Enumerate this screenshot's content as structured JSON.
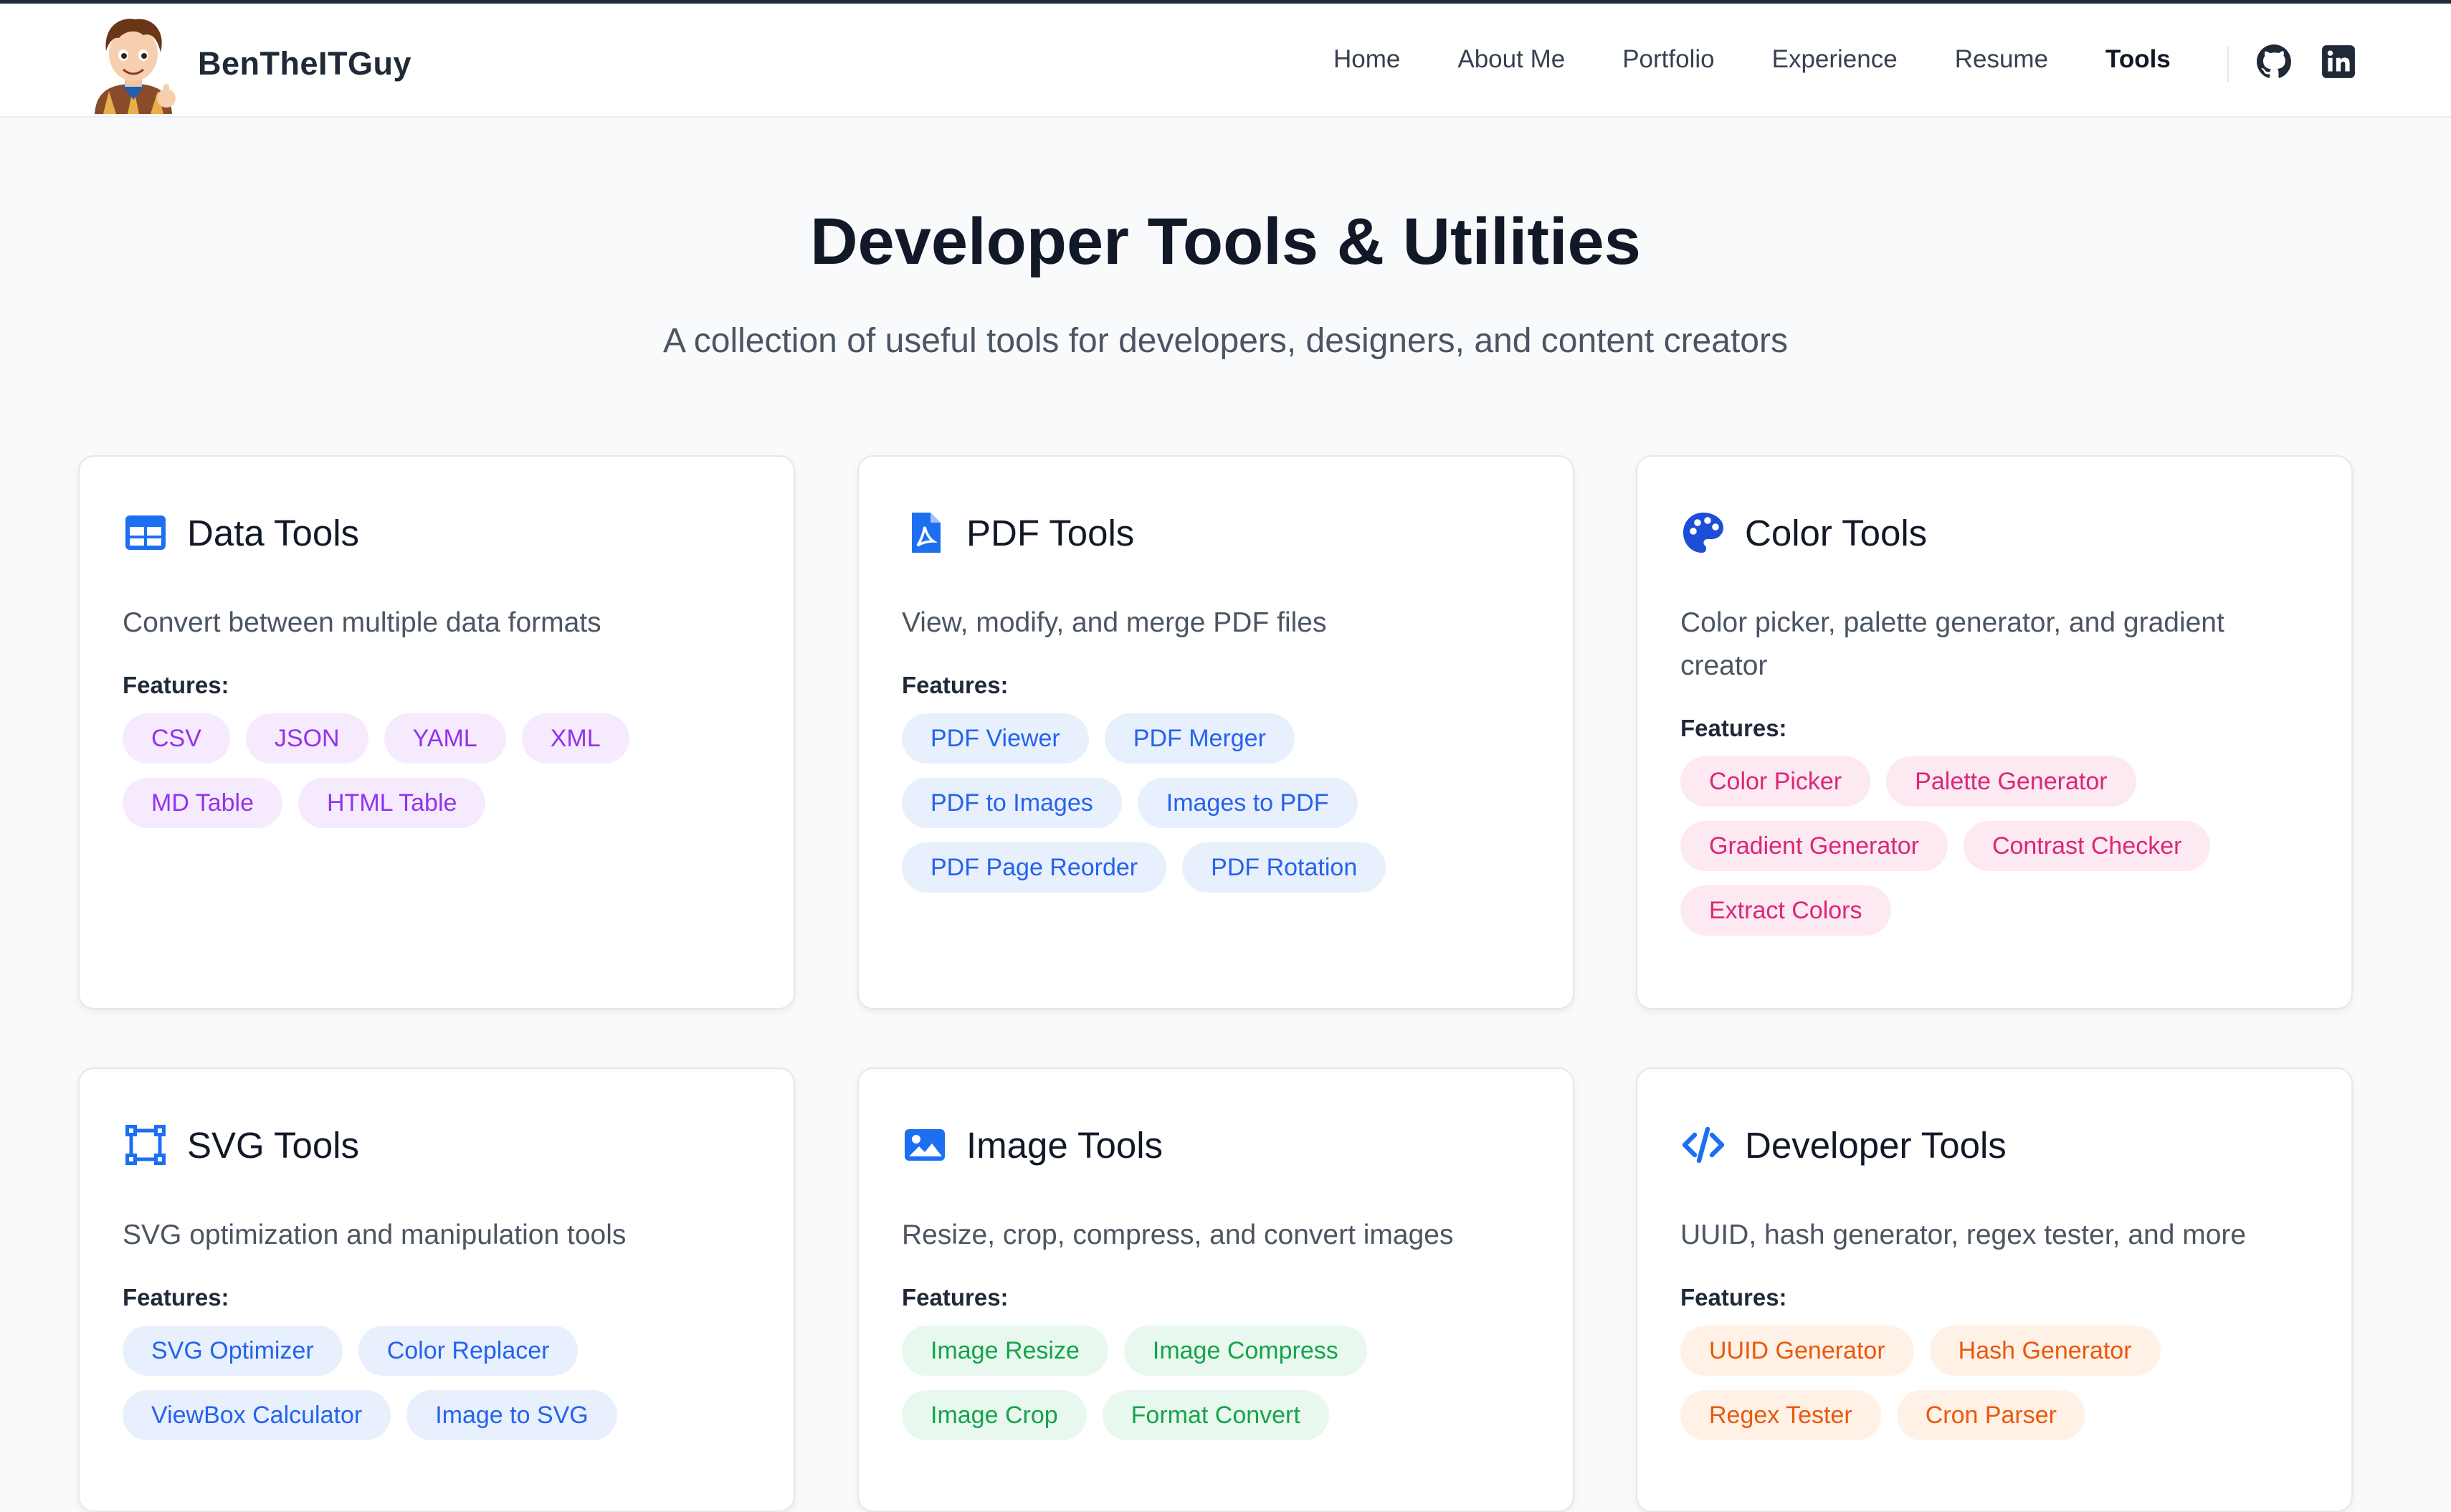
{
  "brand": {
    "name": "BenTheITGuy"
  },
  "nav": {
    "items": [
      {
        "label": "Home",
        "active": false
      },
      {
        "label": "About Me",
        "active": false
      },
      {
        "label": "Portfolio",
        "active": false
      },
      {
        "label": "Experience",
        "active": false
      },
      {
        "label": "Resume",
        "active": false
      },
      {
        "label": "Tools",
        "active": true
      }
    ],
    "social": [
      "github-icon",
      "linkedin-icon"
    ]
  },
  "hero": {
    "title": "Developer Tools & Utilities",
    "subtitle": "A collection of useful tools for developers, designers, and content creators"
  },
  "features_label": "Features:",
  "colors": {
    "purple_text": "#9333ea",
    "purple_bg": "#f5eafe",
    "blue_text": "#2563eb",
    "blue_bg": "#e8f0fe",
    "pink_text": "#db2777",
    "pink_bg": "#fde9f2",
    "green_text": "#16a34a",
    "green_bg": "#e8f8ee",
    "orange_text": "#ea580c",
    "orange_bg": "#fff1e6",
    "icon_blue": "#1d6ff2"
  },
  "cards": [
    {
      "title": "Data Tools",
      "icon": "table-icon",
      "description": "Convert between multiple data formats",
      "features": [
        "CSV",
        "JSON",
        "YAML",
        "XML",
        "MD Table",
        "HTML Table"
      ]
    },
    {
      "title": "PDF Tools",
      "icon": "pdf-file-icon",
      "description": "View, modify, and merge PDF files",
      "features": [
        "PDF Viewer",
        "PDF Merger",
        "PDF to Images",
        "Images to PDF",
        "PDF Page Reorder",
        "PDF Rotation"
      ]
    },
    {
      "title": "Color Tools",
      "icon": "palette-icon",
      "description": "Color picker, palette generator, and gradient creator",
      "features": [
        "Color Picker",
        "Palette Generator",
        "Gradient Generator",
        "Contrast Checker",
        "Extract Colors"
      ]
    },
    {
      "title": "SVG Tools",
      "icon": "vector-square-icon",
      "description": "SVG optimization and manipulation tools",
      "features": [
        "SVG Optimizer",
        "Color Replacer",
        "ViewBox Calculator",
        "Image to SVG"
      ]
    },
    {
      "title": "Image Tools",
      "icon": "image-icon",
      "description": "Resize, crop, compress, and convert images",
      "features": [
        "Image Resize",
        "Image Compress",
        "Image Crop",
        "Format Convert"
      ]
    },
    {
      "title": "Developer Tools",
      "icon": "code-icon",
      "description": "UUID, hash generator, regex tester, and more",
      "features": [
        "UUID Generator",
        "Hash Generator",
        "Regex Tester",
        "Cron Parser"
      ]
    }
  ]
}
